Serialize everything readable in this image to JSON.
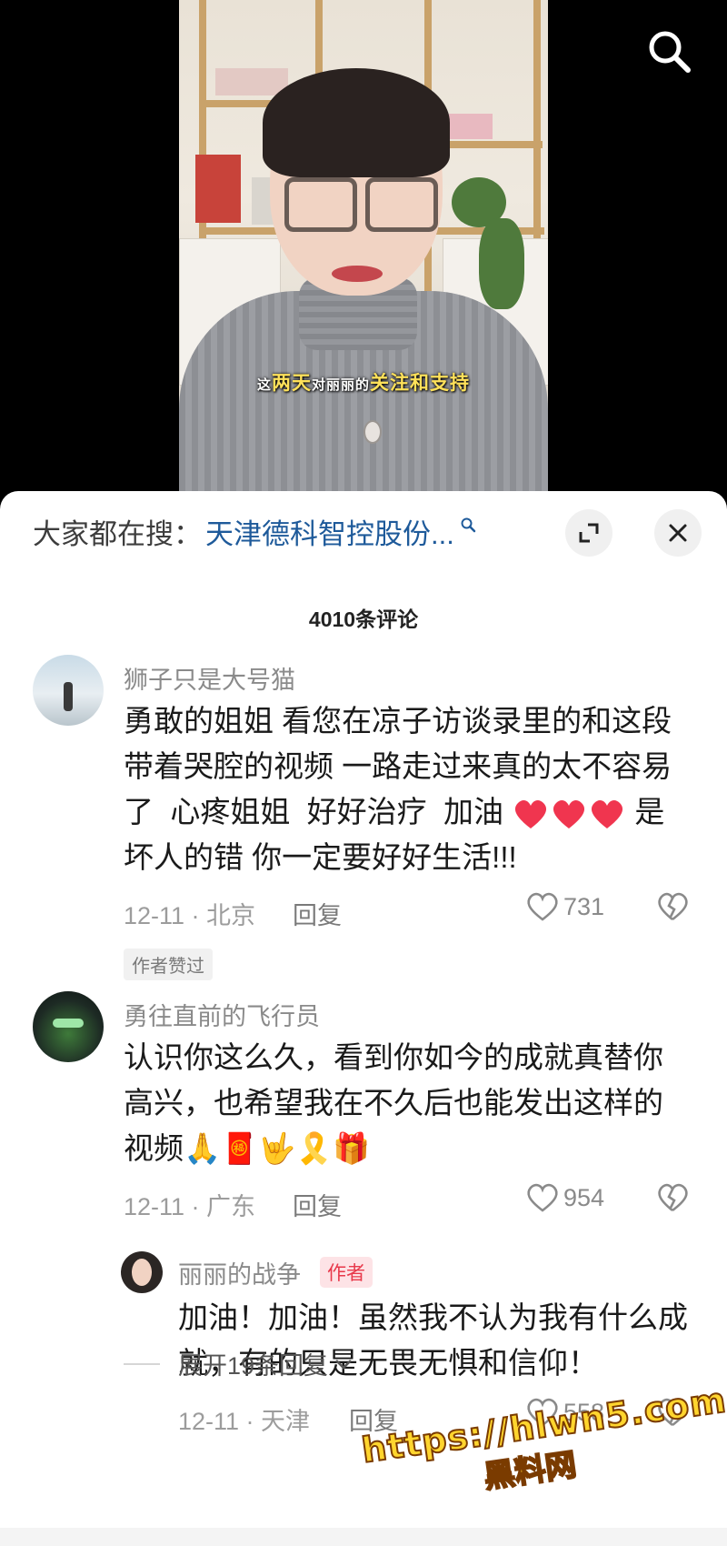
{
  "video": {
    "subtitle_parts": [
      {
        "text": "这",
        "style": "sm"
      },
      {
        "text": "两天",
        "style": "hl"
      },
      {
        "text": "对丽丽的",
        "style": "sm"
      },
      {
        "text": "关注和支持",
        "style": "hl"
      }
    ]
  },
  "top_bar": {
    "search_icon": "search-icon"
  },
  "search_suggest": {
    "prefix": "大家都在搜：",
    "term": "天津德科智控股份...",
    "expand_icon": "expand-icon",
    "close_icon": "close-icon"
  },
  "comments_header": {
    "count_label": "4010条评论"
  },
  "comments": [
    {
      "username": "狮子只是大号猫",
      "lines": [
        "勇敢的姐姐  看您在凉子访谈录里的和这段",
        "带着哭腔的视频  一路走过来真的太不容易",
        "了  心疼姐姐  好好治疗  加油 ❤❤❤ 是",
        "坏人的错 你一定要好好生活!!!"
      ],
      "date_location": "12-11 · 北京",
      "reply_label": "回复",
      "likes": "731",
      "badge": "作者赞过"
    },
    {
      "username": "勇往直前的飞行员",
      "lines": [
        "认识你这么久，看到你如今的成就真替你",
        "高兴，也希望我在不久后也能发出这样的",
        "视频🙏🧧🤟🎗️🎁"
      ],
      "date_location": "12-11 · 广东",
      "reply_label": "回复",
      "likes": "954"
    }
  ],
  "author_reply": {
    "username": "丽丽的战争",
    "badge": "作者",
    "lines": [
      "加油！加油！虽然我不认为我有什么成",
      "就，有的只是无畏无惧和信仰！"
    ],
    "date_location": "12-11 · 天津",
    "reply_label": "回复",
    "likes": "558"
  },
  "expand_replies": {
    "label": "展开19条回复"
  },
  "watermark": {
    "url": "https://hlwn5.com",
    "name": "黑料网"
  },
  "colors": {
    "link": "#1e5a9a",
    "author_badge": "#e8394b",
    "subtitle_highlight": "#ffe15a",
    "heart": "#f0354f"
  }
}
